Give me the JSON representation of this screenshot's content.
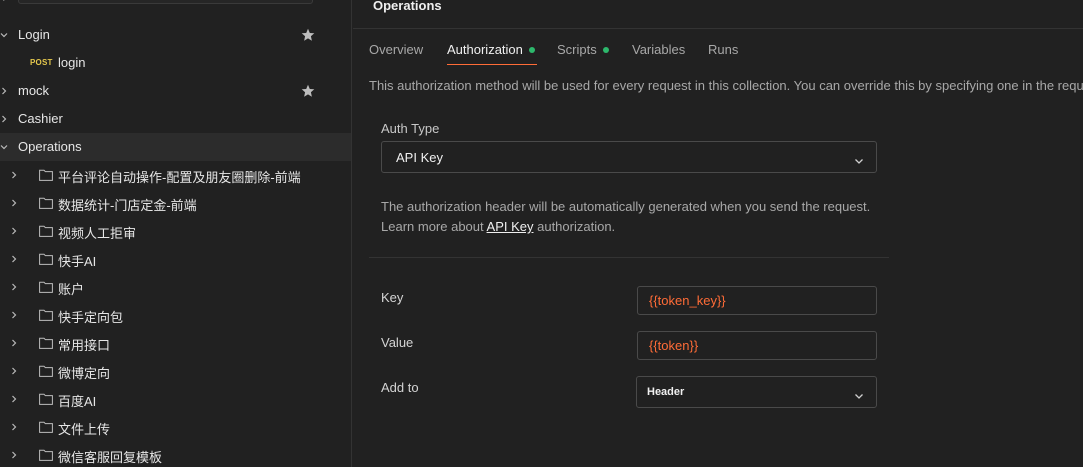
{
  "sidebar": {
    "items": [
      {
        "label": "Login",
        "type": "collection",
        "expanded": true,
        "starred": true
      },
      {
        "label": "login",
        "type": "request",
        "method": "POST"
      },
      {
        "label": "mock",
        "type": "collection",
        "expanded": false,
        "starred": true
      },
      {
        "label": "Cashier",
        "type": "collection",
        "expanded": false
      },
      {
        "label": "Operations",
        "type": "collection",
        "expanded": true,
        "selected": true
      }
    ],
    "folders": [
      "平台评论自动操作-配置及朋友圈删除-前端",
      "数据统计-门店定金-前端",
      "视频人工拒审",
      "快手AI",
      "账户",
      "快手定向包",
      "常用接口",
      "微博定向",
      "百度AI",
      "文件上传",
      "微信客服回复模板"
    ]
  },
  "main": {
    "title": "Operations",
    "tabs": [
      {
        "label": "Overview"
      },
      {
        "label": "Authorization",
        "active": true,
        "dot": true
      },
      {
        "label": "Scripts",
        "dot": true
      },
      {
        "label": "Variables"
      },
      {
        "label": "Runs"
      }
    ],
    "description": "This authorization method will be used for every request in this collection. You can override this by specifying one in the reque",
    "auth_type_label": "Auth Type",
    "auth_type_value": "API Key",
    "info_line1": "The authorization header will be automatically generated when you send the request.",
    "info_line2_prefix": "Learn more about ",
    "info_line2_link": "API Key",
    "info_line2_suffix": " authorization.",
    "key_label": "Key",
    "key_value": "{{token_key}}",
    "value_label": "Value",
    "value_value": "{{token}}",
    "add_to_label": "Add to",
    "add_to_value": "Header"
  },
  "colors": {
    "accent": "#ff6c37",
    "dot": "#2db86c",
    "post": "#e5c84d",
    "background": "#212121"
  }
}
